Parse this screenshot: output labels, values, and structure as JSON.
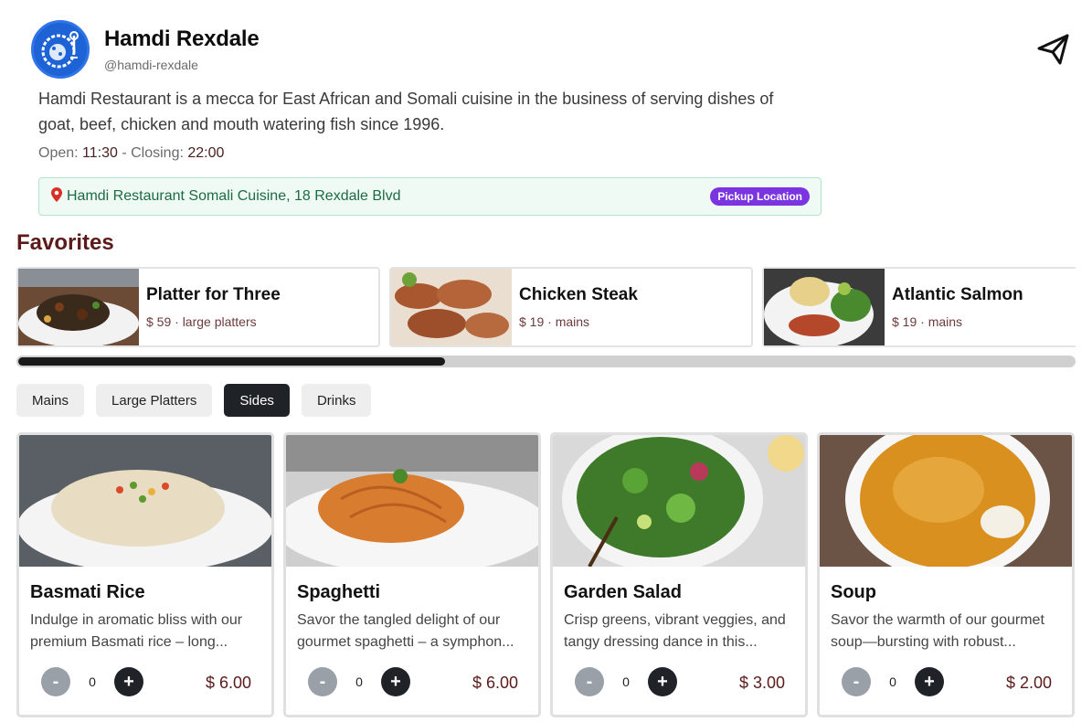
{
  "restaurant": {
    "name": "Hamdi Rexdale",
    "handle": "@hamdi-rexdale",
    "description": "Hamdi Restaurant is a mecca for East African and Somali cuisine in the business of serving dishes of goat, beef, chicken and mouth watering fish since 1996.",
    "open_label": "Open: ",
    "open_time": "11:30",
    "closing_label": " - Closing: ",
    "closing_time": "22:00",
    "location": "Hamdi Restaurant Somali Cuisine, 18 Rexdale Blvd",
    "location_badge": "Pickup Location",
    "icon_send": "paper-plane-icon",
    "icon_location": "map-pin-icon"
  },
  "favorites": {
    "title": "Favorites",
    "scroll_position": 0.4,
    "items": [
      {
        "name": "Platter for Three",
        "meta": "$ 59 · large platters"
      },
      {
        "name": "Chicken Steak",
        "meta": "$ 19 · mains"
      },
      {
        "name": "Atlantic Salmon",
        "meta": "$ 19 · mains"
      }
    ]
  },
  "tabs": [
    {
      "label": "Mains",
      "active": false
    },
    {
      "label": "Large Platters",
      "active": false
    },
    {
      "label": "Sides",
      "active": true
    },
    {
      "label": "Drinks",
      "active": false
    }
  ],
  "products": [
    {
      "name": "Basmati Rice",
      "desc_line1": "Indulge in aromatic bliss with our",
      "desc_line2": "premium Basmati rice – long...",
      "qty": "0",
      "price": "$ 6.00",
      "minus": "-",
      "plus": "+"
    },
    {
      "name": "Spaghetti",
      "desc_line1": "Savor the tangled delight of our",
      "desc_line2": "gourmet spaghetti – a symphon...",
      "qty": "0",
      "price": "$ 6.00",
      "minus": "-",
      "plus": "+"
    },
    {
      "name": "Garden Salad",
      "desc_line1": "Crisp greens, vibrant veggies, and",
      "desc_line2": "tangy dressing dance in this...",
      "qty": "0",
      "price": "$ 3.00",
      "minus": "-",
      "plus": "+"
    },
    {
      "name": "Soup",
      "desc_line1": "Savor the warmth of our gourmet",
      "desc_line2": "soup—bursting with robust...",
      "qty": "0",
      "price": "$ 2.00",
      "minus": "-",
      "plus": "+"
    }
  ],
  "colors": {
    "accent": "#1f2328",
    "badge": "#7b35e0",
    "price": "#5c1a1a",
    "location_bg": "#eefaf3"
  }
}
